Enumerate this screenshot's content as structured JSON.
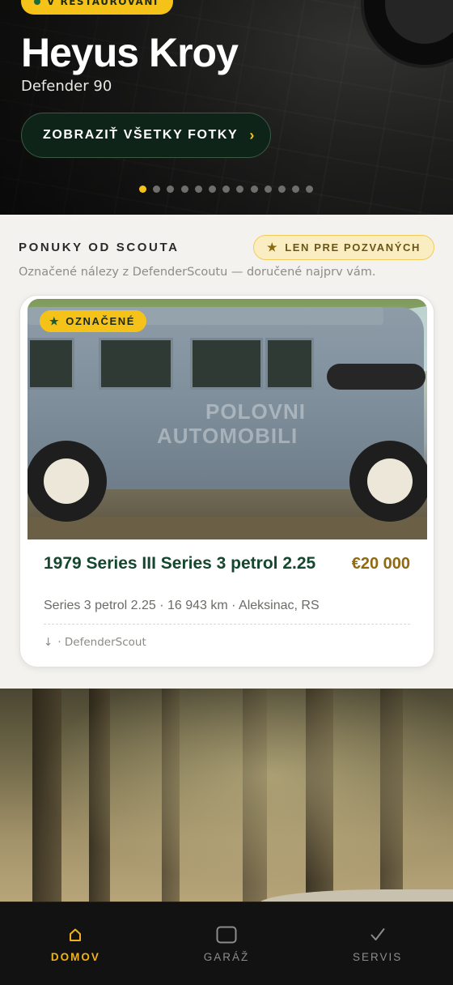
{
  "hero": {
    "status_label": "V RESTAUROVANÍ",
    "title": "Heyus Kroy",
    "subtitle": "Defender 90",
    "photos_button_label": "ZOBRAZIŤ VŠETKY FOTKY",
    "photos_button_chevron": "›",
    "carousel": {
      "total": 13,
      "active_index": 0
    }
  },
  "scout": {
    "title": "PONUKY OD SCOUTA",
    "badge_label": "LEN PRE POZVANÝCH",
    "description": "Označené nálezy z DefenderScoutu — doručené najprv vám.",
    "listing": {
      "tag": "OZNAČENÉ",
      "watermark_line1": "POLOVNI",
      "watermark_line2": "AUTOMOBILI",
      "title": "1979 Series III Series 3 petrol 2.25",
      "price": "€20 000",
      "meta": "Series 3 petrol 2.25 · 16 943 km · Aleksinac, RS",
      "source_icon": "↓",
      "source": "· DefenderScout"
    }
  },
  "nav": {
    "items": [
      {
        "label": "DOMOV",
        "icon": "home-icon",
        "active": true
      },
      {
        "label": "GARÁŽ",
        "icon": "garage-icon",
        "active": false
      },
      {
        "label": "SERVIS",
        "icon": "check-icon",
        "active": false
      }
    ]
  },
  "colors": {
    "accent": "#f5c21a",
    "brand_green": "#15462e",
    "price_gold": "#8f6a12",
    "nav_active": "#f0b21a"
  }
}
